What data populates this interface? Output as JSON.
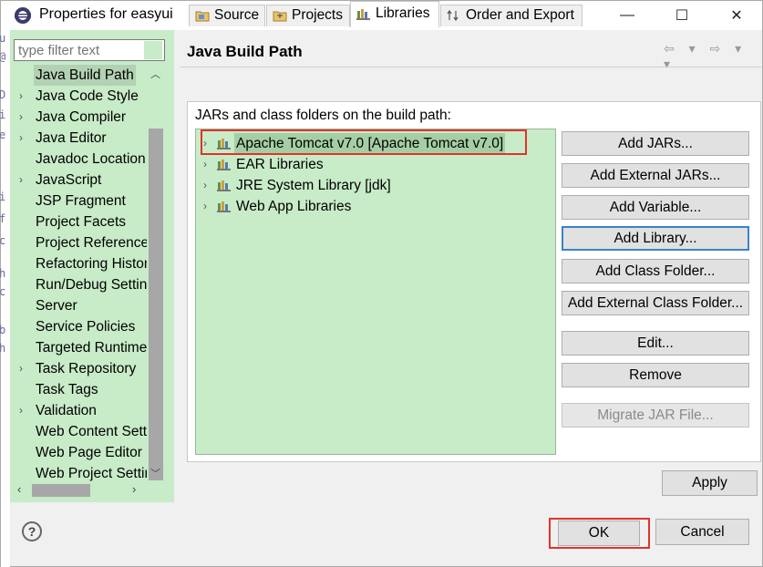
{
  "window": {
    "title": "Properties for easyui",
    "minimize_glyph": "—",
    "maximize_glyph": "☐",
    "close_glyph": "✕"
  },
  "left_strip_fragments": [
    "u",
    "@",
    "D",
    "i",
    "e",
    "i",
    "f",
    "c",
    "h",
    "c",
    "b",
    "h"
  ],
  "sidebar": {
    "filter_placeholder": "type filter text",
    "items": [
      {
        "label": "Java Build Path",
        "expandable": false,
        "selected": true
      },
      {
        "label": "Java Code Style",
        "expandable": true
      },
      {
        "label": "Java Compiler",
        "expandable": true
      },
      {
        "label": "Java Editor",
        "expandable": true
      },
      {
        "label": "Javadoc Location",
        "expandable": false
      },
      {
        "label": "JavaScript",
        "expandable": true
      },
      {
        "label": "JSP Fragment",
        "expandable": false
      },
      {
        "label": "Project Facets",
        "expandable": false
      },
      {
        "label": "Project References",
        "expandable": false
      },
      {
        "label": "Refactoring History",
        "expandable": false
      },
      {
        "label": "Run/Debug Settings",
        "expandable": false
      },
      {
        "label": "Server",
        "expandable": false
      },
      {
        "label": "Service Policies",
        "expandable": false
      },
      {
        "label": "Targeted Runtimes",
        "expandable": false
      },
      {
        "label": "Task Repository",
        "expandable": true
      },
      {
        "label": "Task Tags",
        "expandable": false
      },
      {
        "label": "Validation",
        "expandable": true
      },
      {
        "label": "Web Content Settings",
        "expandable": false
      },
      {
        "label": "Web Page Editor",
        "expandable": false
      },
      {
        "label": "Web Project Settings",
        "expandable": false
      }
    ]
  },
  "main": {
    "page_title": "Java Build Path",
    "nav_arrows": "⇦ ▾ ⇨ ▾ ▾",
    "tabs": [
      {
        "label": "Source"
      },
      {
        "label": "Projects"
      },
      {
        "label": "Libraries",
        "active": true
      },
      {
        "label": "Order and Export"
      }
    ],
    "section_label": "JARs and class folders on the build path:",
    "libraries": [
      {
        "label": "Apache Tomcat v7.0 [Apache Tomcat v7.0]",
        "selected": true
      },
      {
        "label": "EAR Libraries"
      },
      {
        "label": "JRE System Library [jdk]"
      },
      {
        "label": "Web App Libraries"
      }
    ],
    "buttons": {
      "add_jars": "Add JARs...",
      "add_external_jars": "Add External JARs...",
      "add_variable": "Add Variable...",
      "add_library": "Add Library...",
      "add_class_folder": "Add Class Folder...",
      "add_external_class_folder": "Add External Class Folder...",
      "edit": "Edit...",
      "remove": "Remove",
      "migrate_jar": "Migrate JAR File..."
    },
    "apply_label": "Apply"
  },
  "footer": {
    "help_glyph": "?",
    "ok_label": "OK",
    "cancel_label": "Cancel"
  },
  "colors": {
    "panel_bg": "#c8ebc8",
    "highlight_red": "#e0332c",
    "focus_blue": "#3c82c8"
  }
}
